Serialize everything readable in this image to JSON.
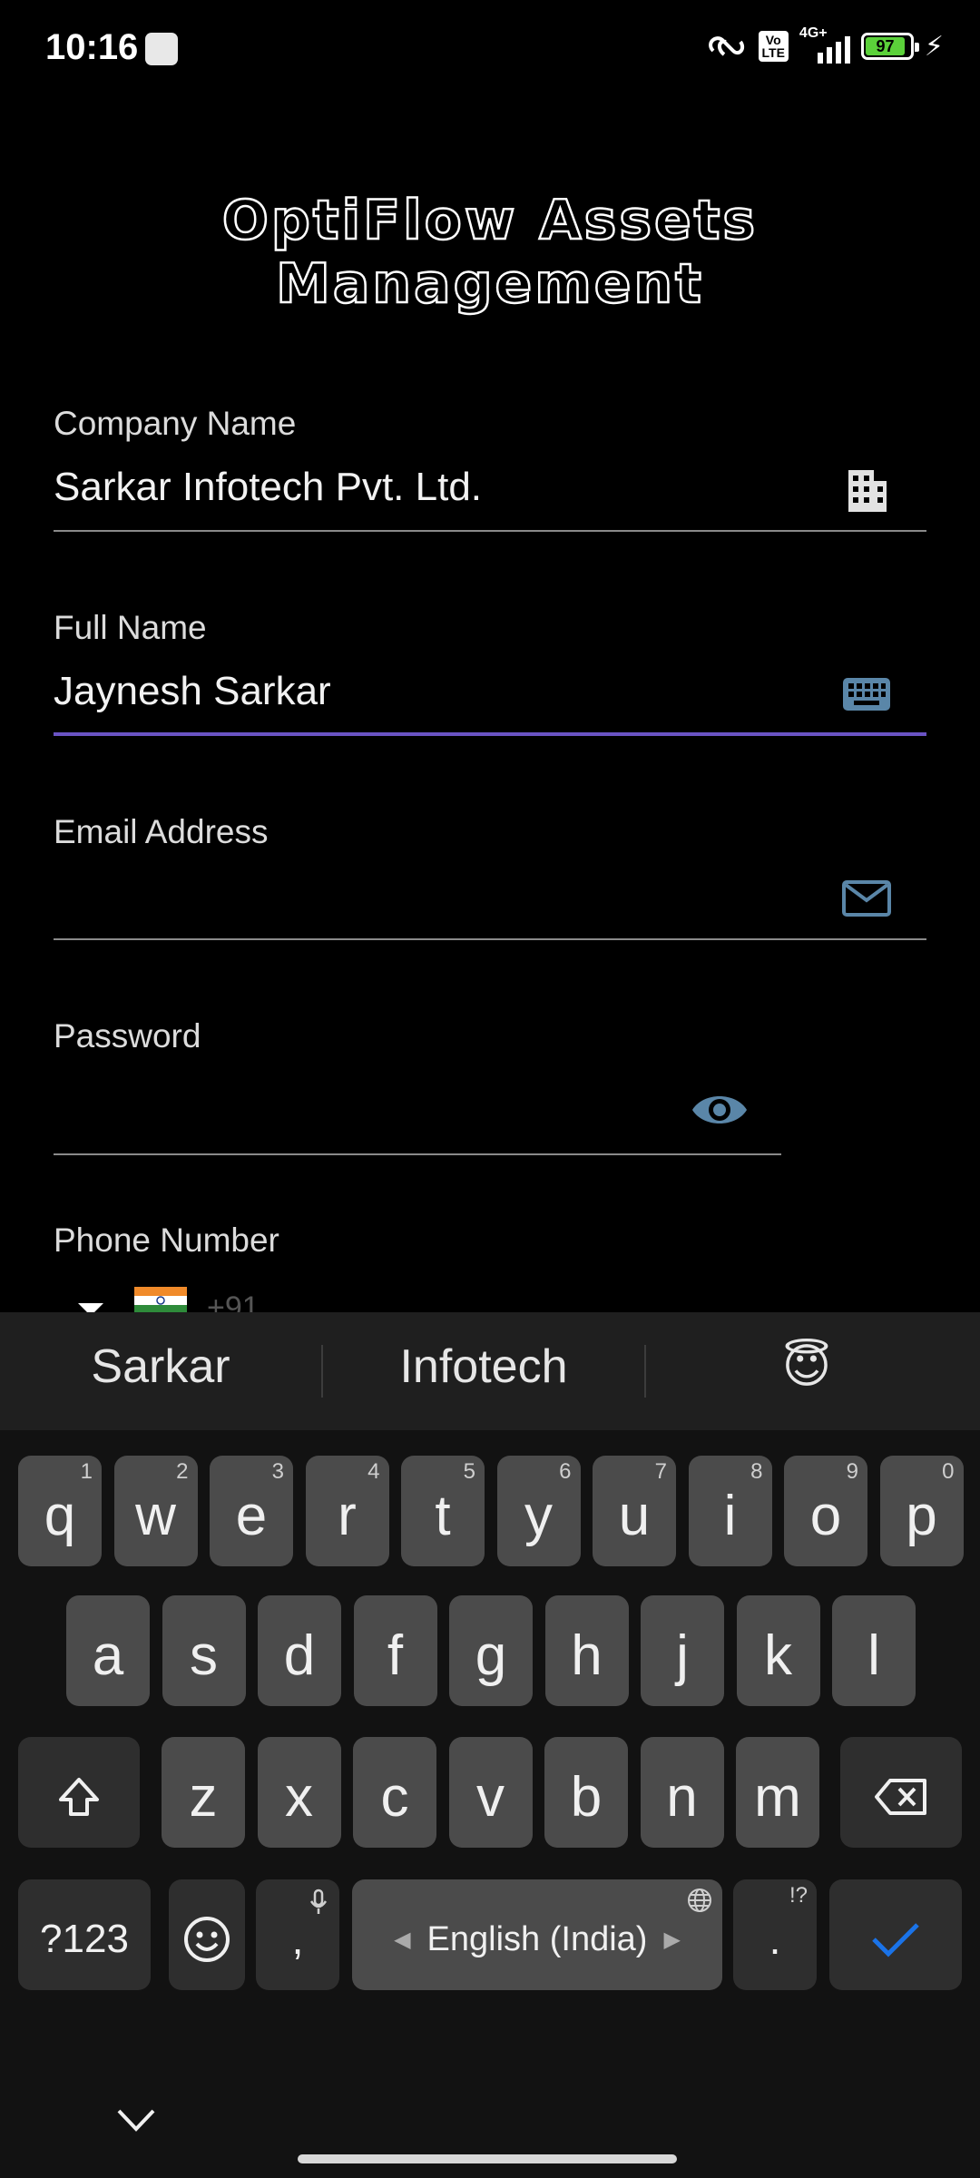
{
  "status_bar": {
    "time": "10:16",
    "network": "4G+",
    "volte": "Vo\nLTE",
    "battery": "97"
  },
  "app": {
    "title": "OptiFlow Assets Management"
  },
  "form": {
    "company": {
      "label": "Company Name",
      "value": "Sarkar Infotech Pvt. Ltd.",
      "icon": "building-icon"
    },
    "full_name": {
      "label": "Full Name",
      "value": "Jaynesh Sarkar",
      "icon": "keyboard-icon"
    },
    "email": {
      "label": "Email Address",
      "value": "",
      "icon": "mail-icon"
    },
    "password": {
      "label": "Password",
      "value": "",
      "icon": "eye-icon"
    },
    "phone": {
      "label": "Phone Number",
      "code": "+91"
    }
  },
  "keyboard": {
    "suggestions": [
      "Sarkar",
      "Infotech",
      "😇"
    ],
    "row1": [
      {
        "k": "q",
        "h": "1"
      },
      {
        "k": "w",
        "h": "2"
      },
      {
        "k": "e",
        "h": "3"
      },
      {
        "k": "r",
        "h": "4"
      },
      {
        "k": "t",
        "h": "5"
      },
      {
        "k": "y",
        "h": "6"
      },
      {
        "k": "u",
        "h": "7"
      },
      {
        "k": "i",
        "h": "8"
      },
      {
        "k": "o",
        "h": "9"
      },
      {
        "k": "p",
        "h": "0"
      }
    ],
    "row2": [
      "a",
      "s",
      "d",
      "f",
      "g",
      "h",
      "j",
      "k",
      "l"
    ],
    "row3": [
      "z",
      "x",
      "c",
      "v",
      "b",
      "n",
      "m"
    ],
    "symbols_label": "?123",
    "comma": ",",
    "space_label": "English (India)",
    "period": ".",
    "period_hint": "!?",
    "colors": {
      "accent": "#1a73e8"
    }
  }
}
